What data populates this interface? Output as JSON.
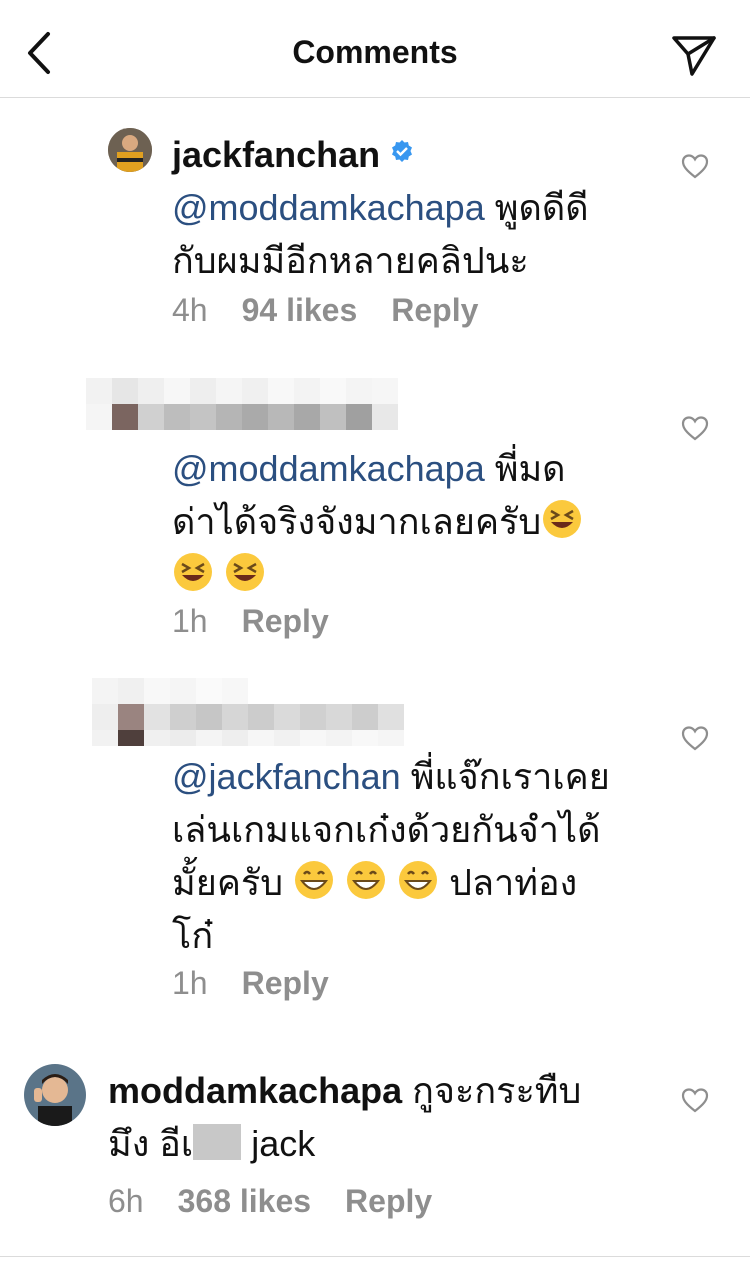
{
  "header": {
    "title": "Comments",
    "back_icon": "chevron-left-icon",
    "send_icon": "paper-plane-icon"
  },
  "colors": {
    "mention": "#2b4f80",
    "meta": "#8e8e8e",
    "verified": "#3897f0",
    "divider": "#dbdbdb"
  },
  "comments": [
    {
      "username": "jackfanchan",
      "verified": true,
      "mention": "@moddamkachapa",
      "text_line1": " พูดดีดี",
      "text_line2": "กับผมมีอีกหลายคลิปนะ",
      "time": "4h",
      "likes": "94 likes",
      "reply": "Reply"
    },
    {
      "username_blurred": true,
      "mention": "@moddamkachapa",
      "text_line1": " พี่มด",
      "text_line2": "ด่าได้จริงจังมากเลยครับ",
      "emoji": "laughing-emoji",
      "time": "1h",
      "reply": "Reply"
    },
    {
      "username_blurred": true,
      "mention": "@jackfanchan",
      "text_line1": " พี่แจ๊กเราเคย",
      "text_line2": "เล่นเกมแจกเก๋งด้วยกันจำได้",
      "text_line3a": "มั้ยครับ ",
      "text_line3b": " ปลาท่อง",
      "text_line4": "โก๋",
      "emoji": "grinning-emoji",
      "time": "1h",
      "reply": "Reply"
    },
    {
      "username": "moddamkachapa",
      "text_line1": " กูจะกระทืบ",
      "text_line2a": "มึง อีเ",
      "text_line2b": " jack",
      "time": "6h",
      "likes": "368 likes",
      "reply": "Reply"
    }
  ]
}
